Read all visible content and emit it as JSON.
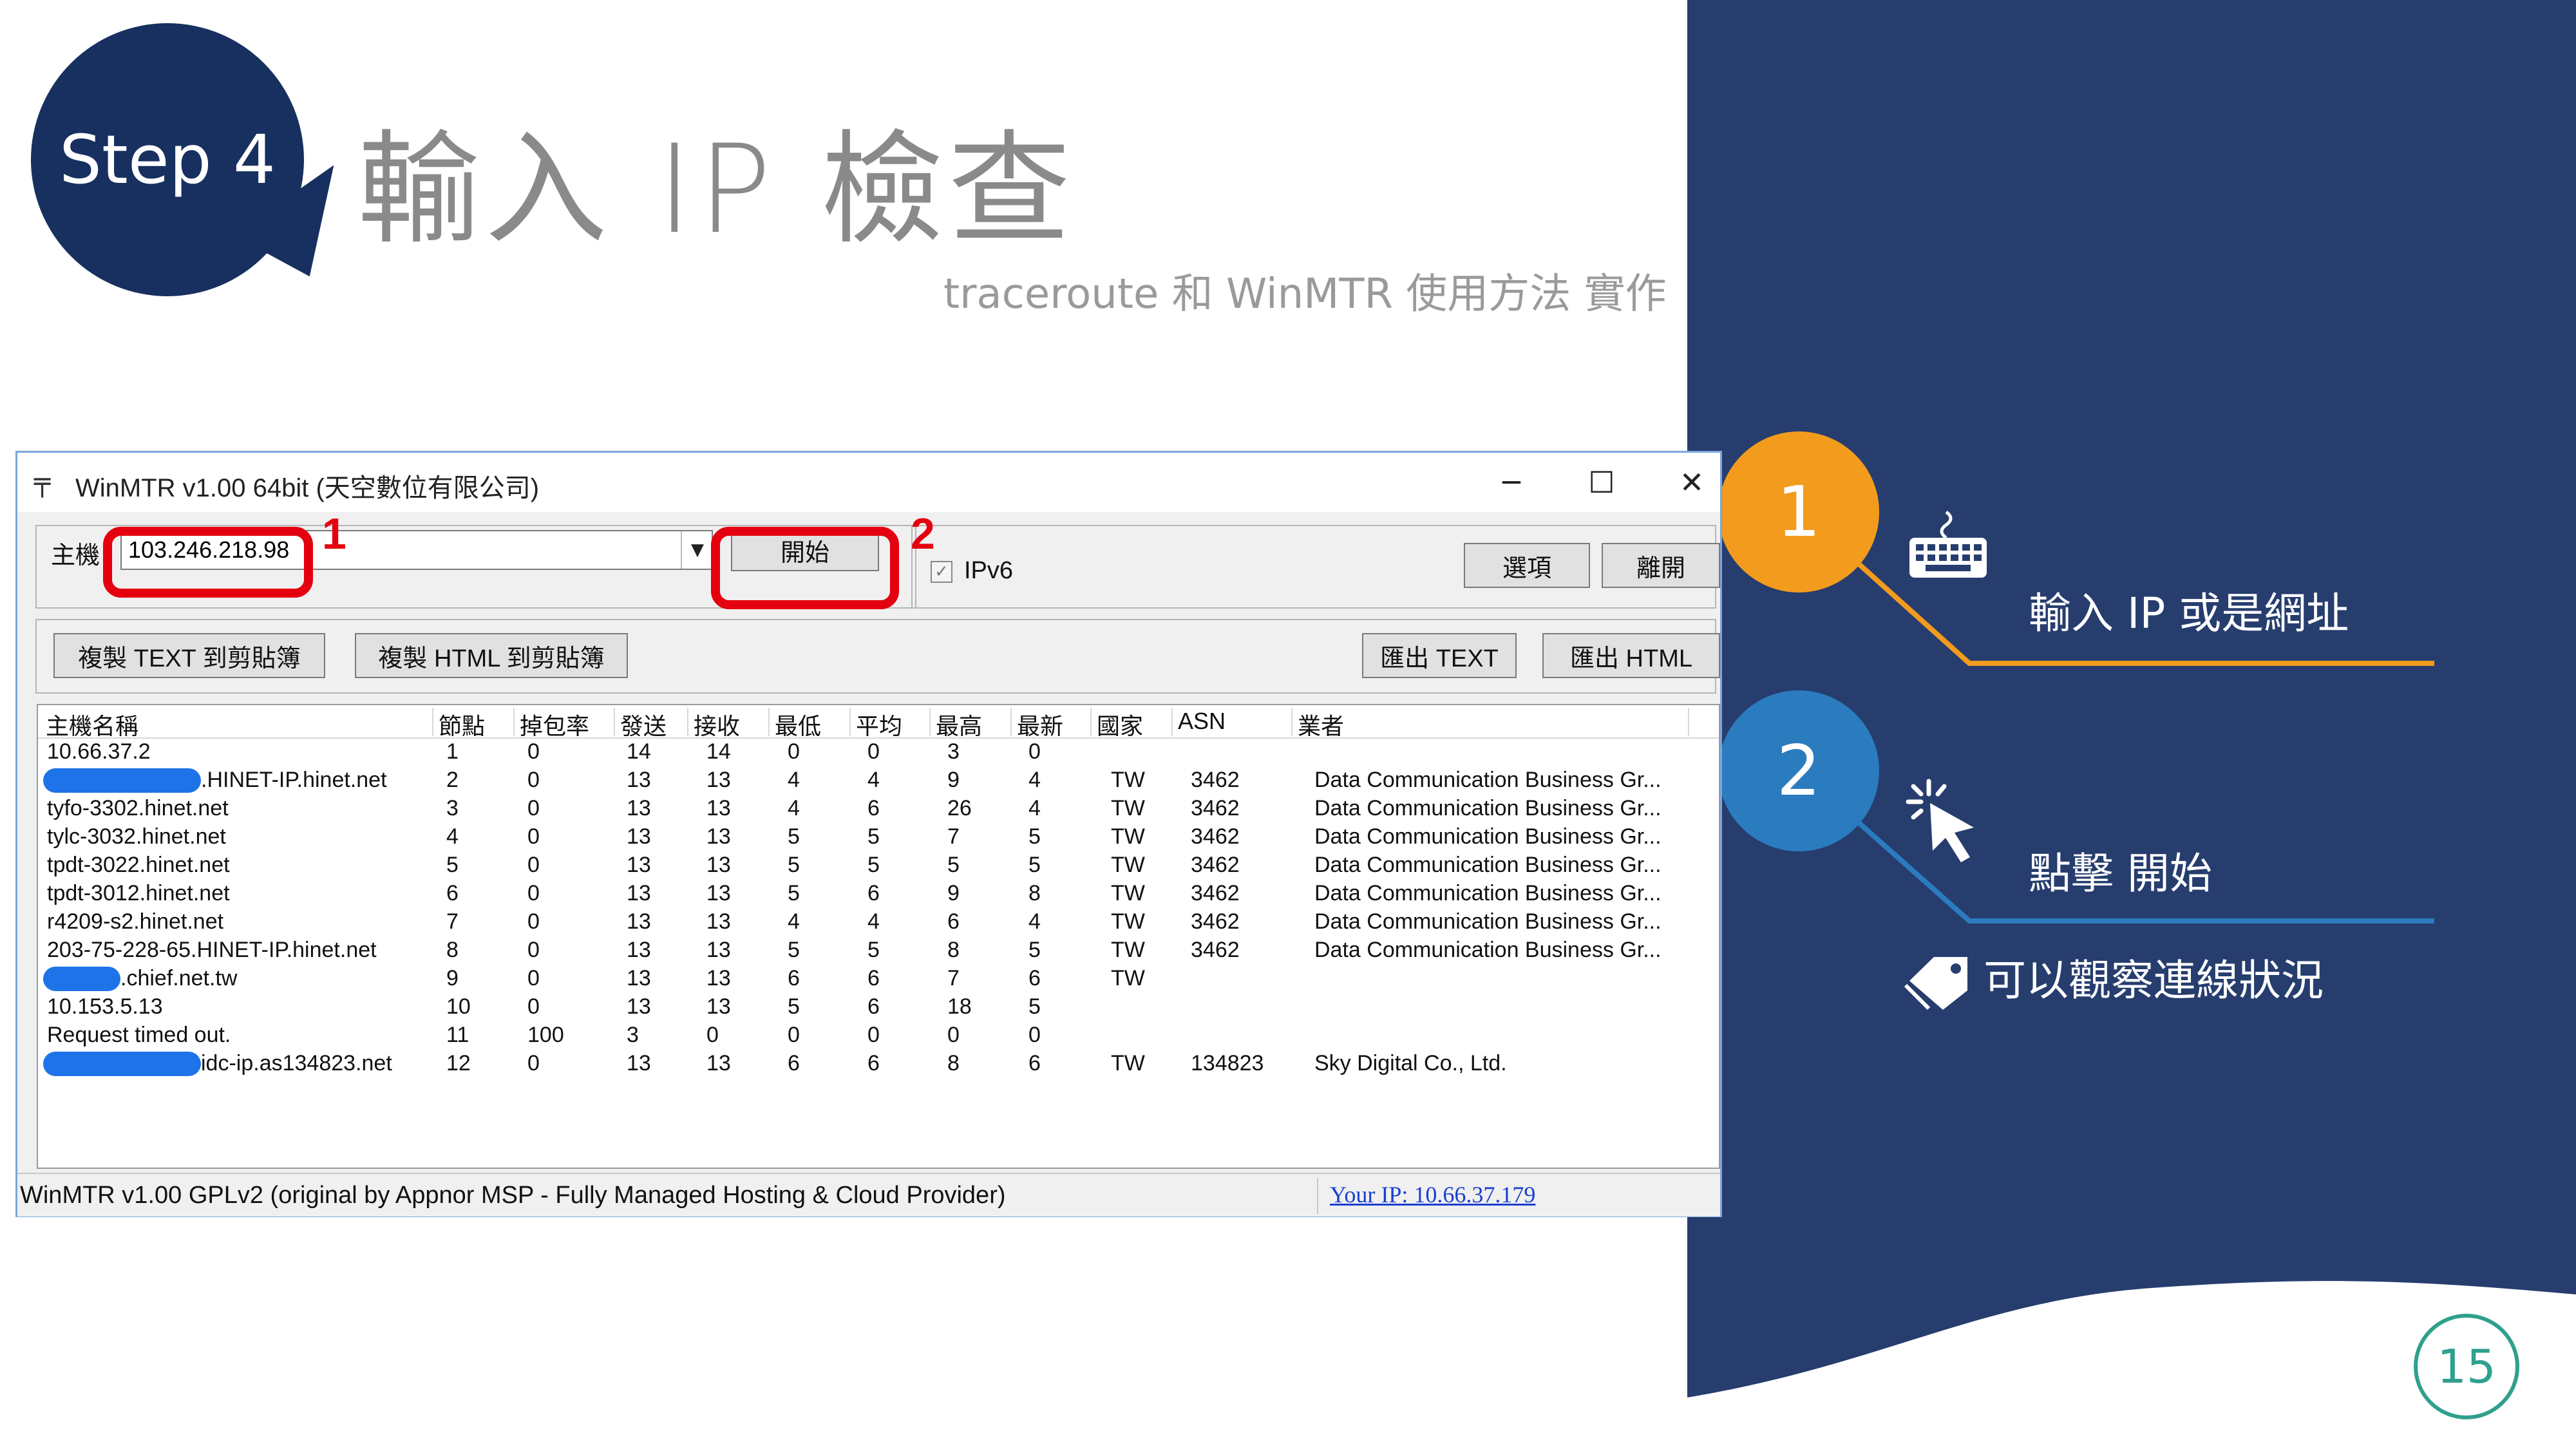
{
  "slide": {
    "step_label": "Step 4",
    "title": "輸入 IP 檢查",
    "subtitle": "traceroute 和 WinMTR 使用方法 實作",
    "page_number": "15"
  },
  "panel": {
    "step1_number": "1",
    "step1_text": "輸入 IP 或是網址",
    "step1_icon": "keyboard-icon",
    "step2_number": "2",
    "step2_text": "點擊 開始",
    "step2_icon": "cursor-click-icon",
    "note_text": "可以觀察連線狀況",
    "note_icon": "tag-icon",
    "colors": {
      "panel": "#263d6e",
      "step1": "#f29b1d",
      "step2": "#2b7bbf",
      "page_ring": "#2fa08d"
    }
  },
  "winmtr": {
    "title": "WinMTR v1.00 64bit (天空數位有限公司)",
    "host_label": "主機",
    "host_value": "103.246.218.98",
    "start_button": "開始",
    "ipv6_label": "IPv6",
    "options_button": "選項",
    "exit_button": "離開",
    "copy_text_button": "複製 TEXT 到剪貼簿",
    "copy_html_button": "複製 HTML 到剪貼簿",
    "export_text_button": "匯出 TEXT",
    "export_html_button": "匯出 HTML",
    "callout_1": "1",
    "callout_2": "2",
    "columns": [
      "主機名稱",
      "節點",
      "掉包率",
      "發送",
      "接收",
      "最低",
      "平均",
      "最高",
      "最新",
      "國家",
      "ASN",
      "業者"
    ],
    "rows": [
      [
        "10.66.37.2",
        "1",
        "0",
        "14",
        "14",
        "0",
        "0",
        "3",
        "0",
        "",
        "",
        ""
      ],
      [
        ".HINET-IP.hinet.net",
        "2",
        "0",
        "13",
        "13",
        "4",
        "4",
        "9",
        "4",
        "TW",
        "3462",
        "Data Communication Business Gr..."
      ],
      [
        "tyfo-3302.hinet.net",
        "3",
        "0",
        "13",
        "13",
        "4",
        "6",
        "26",
        "4",
        "TW",
        "3462",
        "Data Communication Business Gr..."
      ],
      [
        "tylc-3032.hinet.net",
        "4",
        "0",
        "13",
        "13",
        "5",
        "5",
        "7",
        "5",
        "TW",
        "3462",
        "Data Communication Business Gr..."
      ],
      [
        "tpdt-3022.hinet.net",
        "5",
        "0",
        "13",
        "13",
        "5",
        "5",
        "5",
        "5",
        "TW",
        "3462",
        "Data Communication Business Gr..."
      ],
      [
        "tpdt-3012.hinet.net",
        "6",
        "0",
        "13",
        "13",
        "5",
        "6",
        "9",
        "8",
        "TW",
        "3462",
        "Data Communication Business Gr..."
      ],
      [
        "r4209-s2.hinet.net",
        "7",
        "0",
        "13",
        "13",
        "4",
        "4",
        "6",
        "4",
        "TW",
        "3462",
        "Data Communication Business Gr..."
      ],
      [
        "203-75-228-65.HINET-IP.hinet.net",
        "8",
        "0",
        "13",
        "13",
        "5",
        "5",
        "8",
        "5",
        "TW",
        "3462",
        "Data Communication Business Gr..."
      ],
      [
        ".chief.net.tw",
        "9",
        "0",
        "13",
        "13",
        "6",
        "6",
        "7",
        "6",
        "TW",
        "",
        ""
      ],
      [
        "10.153.5.13",
        "10",
        "0",
        "13",
        "13",
        "5",
        "6",
        "18",
        "5",
        "",
        "",
        ""
      ],
      [
        "Request timed out.",
        "11",
        "100",
        "3",
        "0",
        "0",
        "0",
        "0",
        "0",
        "",
        "",
        ""
      ],
      [
        "idc-ip.as134823.net",
        "12",
        "0",
        "13",
        "13",
        "6",
        "6",
        "8",
        "6",
        "TW",
        "134823",
        "Sky Digital Co., Ltd."
      ]
    ],
    "status_text": "WinMTR v1.00 GPLv2 (original by Appnor MSP - Fully Managed Hosting & Cloud Provider)",
    "your_ip": "Your IP: 10.66.37.179"
  }
}
